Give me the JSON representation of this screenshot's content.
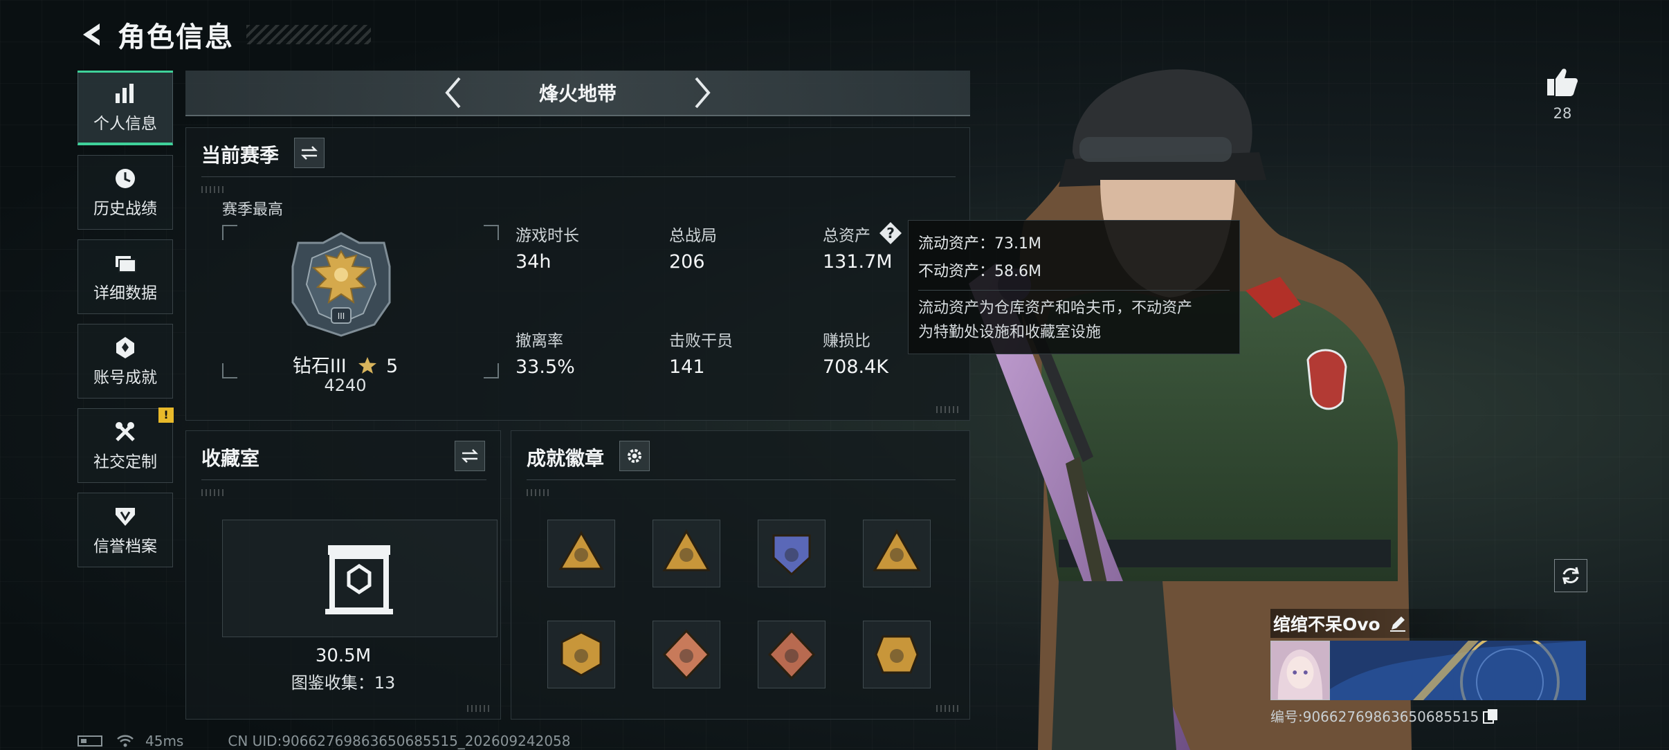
{
  "header": {
    "title": "角色信息"
  },
  "sidenav": {
    "items": [
      {
        "label": "个人信息",
        "active": true,
        "icon": "bar-chart-icon"
      },
      {
        "label": "历史战绩",
        "active": false,
        "icon": "clock-icon"
      },
      {
        "label": "详细数据",
        "active": false,
        "icon": "folder-icon"
      },
      {
        "label": "账号成就",
        "active": false,
        "icon": "achievement-icon"
      },
      {
        "label": "社交定制",
        "active": false,
        "icon": "tools-icon",
        "badge": "!"
      },
      {
        "label": "信誉档案",
        "active": false,
        "icon": "shield-icon"
      }
    ]
  },
  "mode": {
    "name": "烽火地带"
  },
  "season": {
    "title": "当前赛季",
    "best_label": "赛季最高",
    "rank_name": "钻石III",
    "rank_stars": "5",
    "rank_score": "4240",
    "stats": [
      {
        "label": "游戏时长",
        "value": "34h"
      },
      {
        "label": "总战局",
        "value": "206"
      },
      {
        "label": "总资产",
        "value": "131.7M"
      },
      {
        "label": "撤离率",
        "value": "33.5%"
      },
      {
        "label": "击败干员",
        "value": "141"
      },
      {
        "label": "赚损比",
        "value": "708.4K"
      }
    ]
  },
  "tooltip": {
    "liquid": "流动资产：73.1M",
    "fixed": "不动资产：58.6M",
    "desc_line1": "流动资产为仓库资产和哈夫币，不动资产",
    "desc_line2": "为特勤处设施和收藏室设施"
  },
  "collection": {
    "title": "收藏室",
    "value": "30.5M",
    "count_text": "图鉴收集：13"
  },
  "badges": {
    "title": "成就徽章",
    "items": [
      {
        "name": "badge-1",
        "color": "#c8963a"
      },
      {
        "name": "badge-2",
        "color": "#c8963a"
      },
      {
        "name": "badge-3",
        "color": "#5a68b8"
      },
      {
        "name": "badge-4",
        "color": "#c8963a"
      },
      {
        "name": "badge-5",
        "color": "#c8963a"
      },
      {
        "name": "badge-6",
        "color": "#c87a5a"
      },
      {
        "name": "badge-7",
        "color": "#b86a50"
      },
      {
        "name": "badge-8",
        "color": "#c8963a"
      }
    ]
  },
  "social": {
    "likes": "28"
  },
  "player": {
    "name": "绾绾不呆Ovo",
    "id_text": "编号:90662769863650685515"
  },
  "statusbar": {
    "ping": "45ms",
    "uid": "CN UID:90662769863650685515_202609242058"
  },
  "colors": {
    "accent": "#3fd19a",
    "warning": "#e8b92a"
  }
}
